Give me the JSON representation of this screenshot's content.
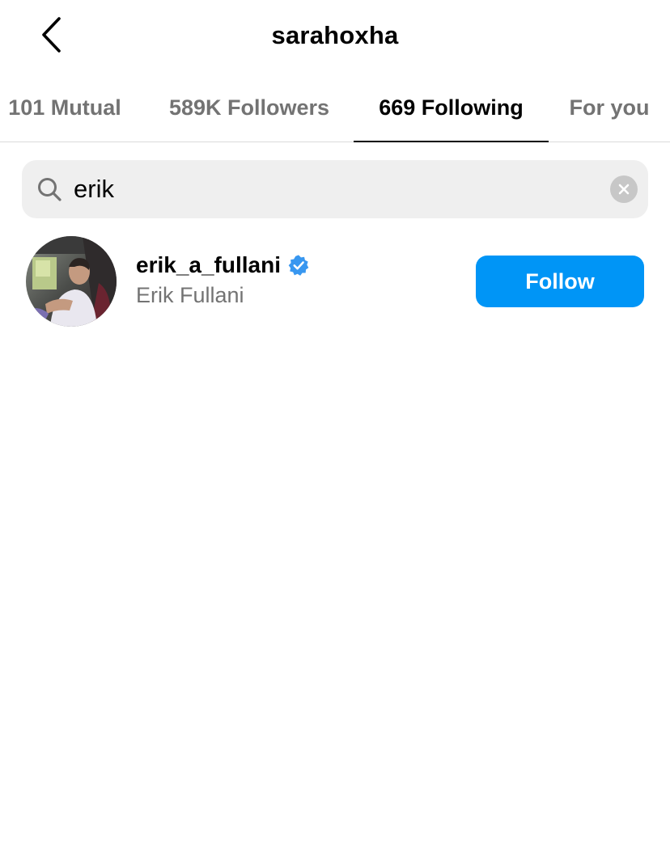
{
  "header": {
    "title": "sarahoxha",
    "back_icon": "chevron-left-icon"
  },
  "tabs": [
    {
      "label": "101 Mutual",
      "active": false
    },
    {
      "label": "589K Followers",
      "active": false
    },
    {
      "label": "669 Following",
      "active": true
    },
    {
      "label": "For you",
      "active": false
    }
  ],
  "search": {
    "value": "erik",
    "icon": "search-icon",
    "clear_icon": "clear-icon"
  },
  "results": [
    {
      "username": "erik_a_fullani",
      "full_name": "Erik Fullani",
      "verified": true,
      "button_label": "Follow"
    }
  ],
  "colors": {
    "accent": "#0095f6",
    "verified_badge": "#3897f0",
    "muted_text": "#737373",
    "search_bg": "#efefef"
  }
}
